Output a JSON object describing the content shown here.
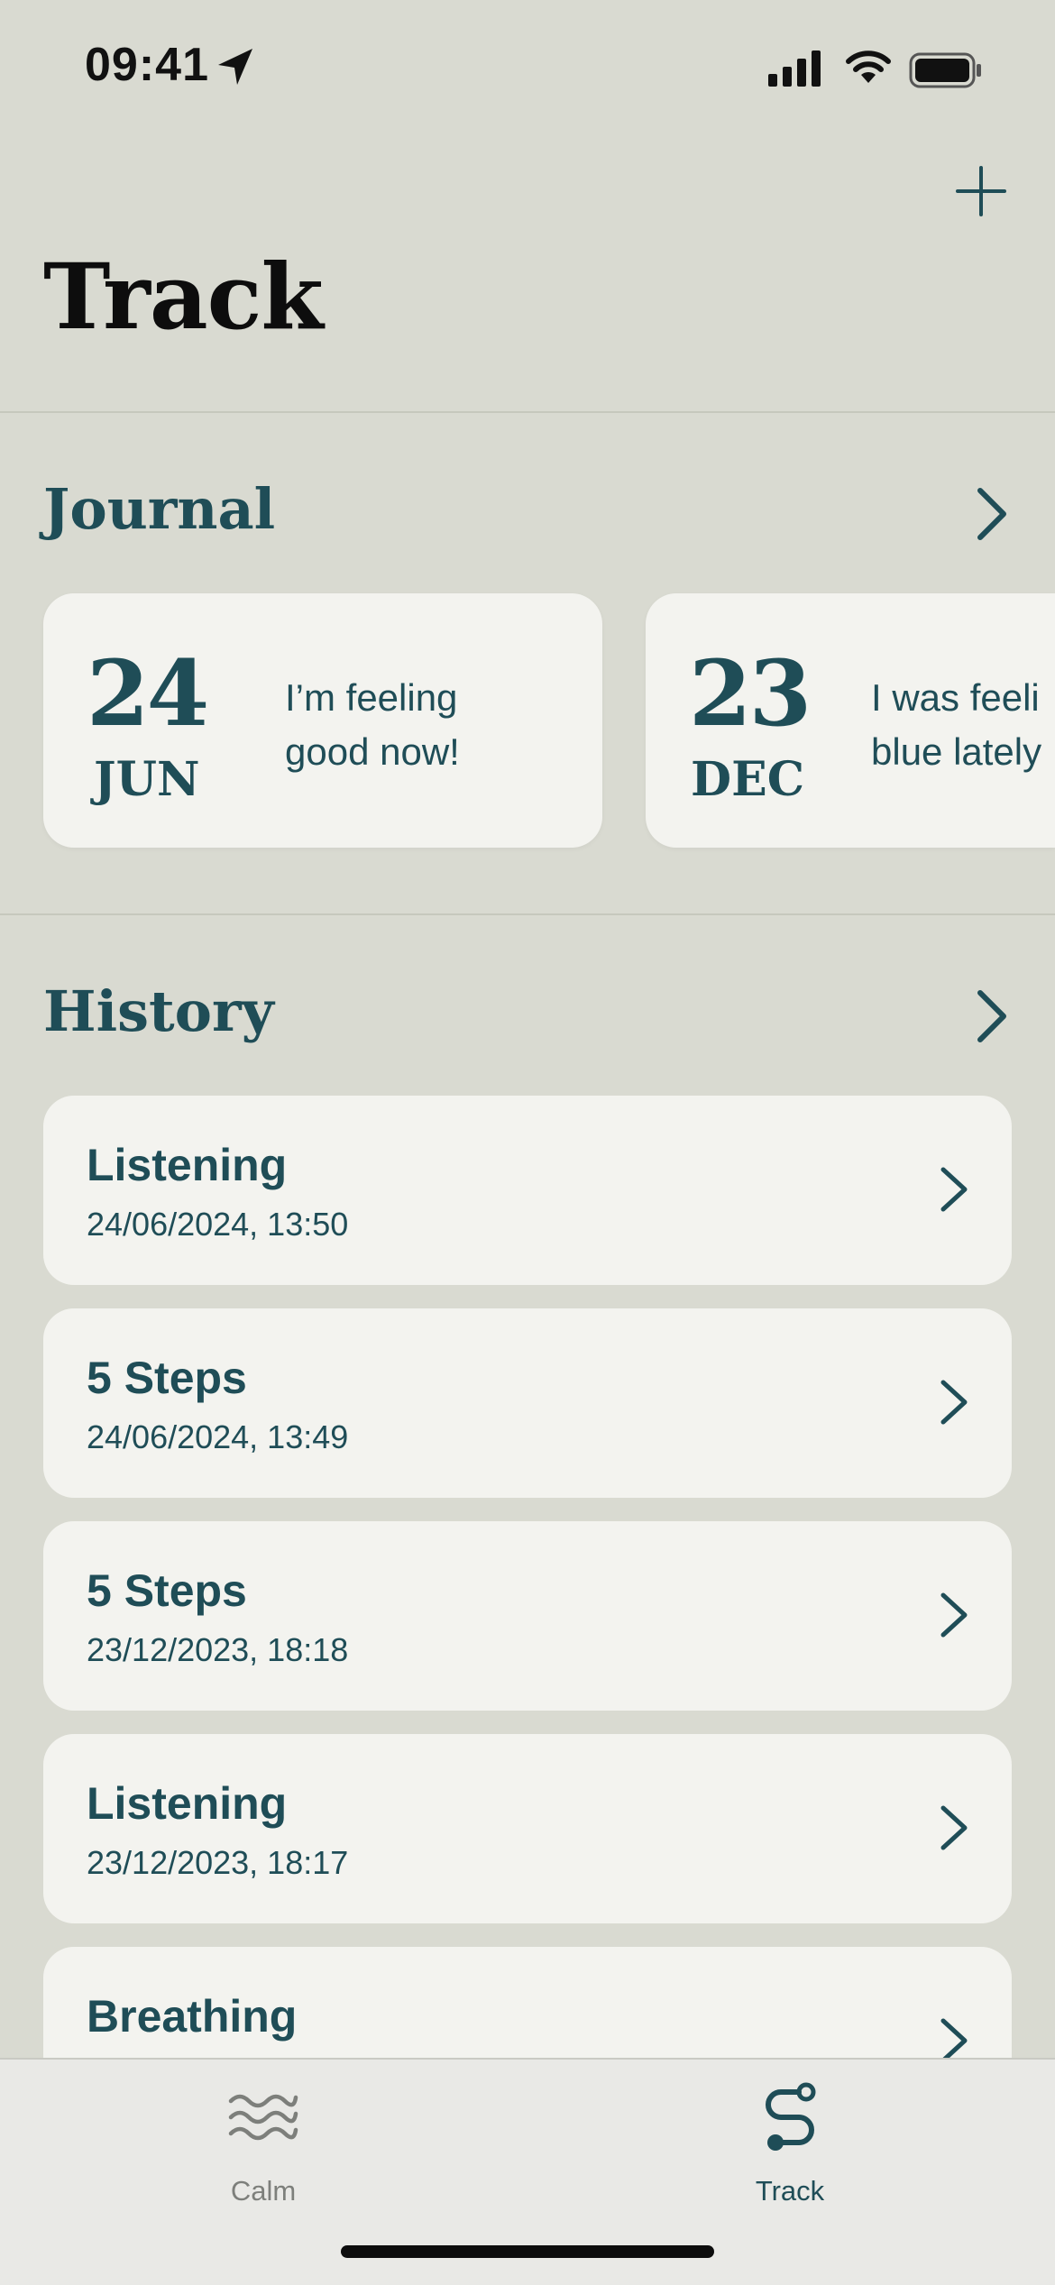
{
  "status_bar": {
    "time": "09:41"
  },
  "header": {
    "title": "Track",
    "add_icon": "plus-icon"
  },
  "journal": {
    "title": "Journal",
    "entries": [
      {
        "day": "24",
        "month": "JUN",
        "text_line1": "I’m feeling",
        "text_line2": "good now!"
      },
      {
        "day": "23",
        "month": "DEC",
        "text_line1": "I was feeli",
        "text_line2": "blue lately"
      }
    ]
  },
  "history": {
    "title": "History",
    "items": [
      {
        "title": "Listening",
        "date": "24/06/2024, 13:50"
      },
      {
        "title": "5 Steps",
        "date": "24/06/2024, 13:49"
      },
      {
        "title": "5 Steps",
        "date": "23/12/2023, 18:18"
      },
      {
        "title": "Listening",
        "date": "23/12/2023, 18:17"
      },
      {
        "title": "Breathing",
        "date": ""
      }
    ]
  },
  "tab_bar": {
    "tabs": [
      {
        "label": "Calm",
        "icon": "waves-icon",
        "active": false
      },
      {
        "label": "Track",
        "icon": "path-icon",
        "active": true
      }
    ]
  },
  "colors": {
    "accent": "#1f4d57",
    "background": "#d9dad1",
    "card": "#f3f3ef",
    "inactive": "#7d7f7b"
  }
}
